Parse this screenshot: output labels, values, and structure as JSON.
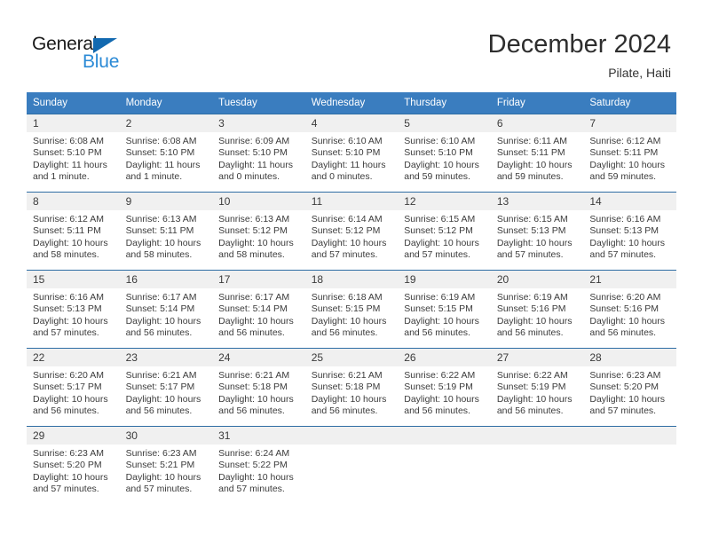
{
  "brand": {
    "name_part1": "General",
    "name_part2": "Blue",
    "accent_color": "#1269b0",
    "blue_text_color": "#2b8ad6"
  },
  "header": {
    "month_title": "December 2024",
    "location": "Pilate, Haiti"
  },
  "calendar": {
    "header_bg": "#3a7dbf",
    "row_divider_color": "#2e6da4",
    "daynum_bg": "#f0f0f0",
    "weekday_headers": [
      "Sunday",
      "Monday",
      "Tuesday",
      "Wednesday",
      "Thursday",
      "Friday",
      "Saturday"
    ],
    "weeks": [
      [
        {
          "day": "1",
          "sunrise": "Sunrise: 6:08 AM",
          "sunset": "Sunset: 5:10 PM",
          "daylight": "Daylight: 11 hours and 1 minute."
        },
        {
          "day": "2",
          "sunrise": "Sunrise: 6:08 AM",
          "sunset": "Sunset: 5:10 PM",
          "daylight": "Daylight: 11 hours and 1 minute."
        },
        {
          "day": "3",
          "sunrise": "Sunrise: 6:09 AM",
          "sunset": "Sunset: 5:10 PM",
          "daylight": "Daylight: 11 hours and 0 minutes."
        },
        {
          "day": "4",
          "sunrise": "Sunrise: 6:10 AM",
          "sunset": "Sunset: 5:10 PM",
          "daylight": "Daylight: 11 hours and 0 minutes."
        },
        {
          "day": "5",
          "sunrise": "Sunrise: 6:10 AM",
          "sunset": "Sunset: 5:10 PM",
          "daylight": "Daylight: 10 hours and 59 minutes."
        },
        {
          "day": "6",
          "sunrise": "Sunrise: 6:11 AM",
          "sunset": "Sunset: 5:11 PM",
          "daylight": "Daylight: 10 hours and 59 minutes."
        },
        {
          "day": "7",
          "sunrise": "Sunrise: 6:12 AM",
          "sunset": "Sunset: 5:11 PM",
          "daylight": "Daylight: 10 hours and 59 minutes."
        }
      ],
      [
        {
          "day": "8",
          "sunrise": "Sunrise: 6:12 AM",
          "sunset": "Sunset: 5:11 PM",
          "daylight": "Daylight: 10 hours and 58 minutes."
        },
        {
          "day": "9",
          "sunrise": "Sunrise: 6:13 AM",
          "sunset": "Sunset: 5:11 PM",
          "daylight": "Daylight: 10 hours and 58 minutes."
        },
        {
          "day": "10",
          "sunrise": "Sunrise: 6:13 AM",
          "sunset": "Sunset: 5:12 PM",
          "daylight": "Daylight: 10 hours and 58 minutes."
        },
        {
          "day": "11",
          "sunrise": "Sunrise: 6:14 AM",
          "sunset": "Sunset: 5:12 PM",
          "daylight": "Daylight: 10 hours and 57 minutes."
        },
        {
          "day": "12",
          "sunrise": "Sunrise: 6:15 AM",
          "sunset": "Sunset: 5:12 PM",
          "daylight": "Daylight: 10 hours and 57 minutes."
        },
        {
          "day": "13",
          "sunrise": "Sunrise: 6:15 AM",
          "sunset": "Sunset: 5:13 PM",
          "daylight": "Daylight: 10 hours and 57 minutes."
        },
        {
          "day": "14",
          "sunrise": "Sunrise: 6:16 AM",
          "sunset": "Sunset: 5:13 PM",
          "daylight": "Daylight: 10 hours and 57 minutes."
        }
      ],
      [
        {
          "day": "15",
          "sunrise": "Sunrise: 6:16 AM",
          "sunset": "Sunset: 5:13 PM",
          "daylight": "Daylight: 10 hours and 57 minutes."
        },
        {
          "day": "16",
          "sunrise": "Sunrise: 6:17 AM",
          "sunset": "Sunset: 5:14 PM",
          "daylight": "Daylight: 10 hours and 56 minutes."
        },
        {
          "day": "17",
          "sunrise": "Sunrise: 6:17 AM",
          "sunset": "Sunset: 5:14 PM",
          "daylight": "Daylight: 10 hours and 56 minutes."
        },
        {
          "day": "18",
          "sunrise": "Sunrise: 6:18 AM",
          "sunset": "Sunset: 5:15 PM",
          "daylight": "Daylight: 10 hours and 56 minutes."
        },
        {
          "day": "19",
          "sunrise": "Sunrise: 6:19 AM",
          "sunset": "Sunset: 5:15 PM",
          "daylight": "Daylight: 10 hours and 56 minutes."
        },
        {
          "day": "20",
          "sunrise": "Sunrise: 6:19 AM",
          "sunset": "Sunset: 5:16 PM",
          "daylight": "Daylight: 10 hours and 56 minutes."
        },
        {
          "day": "21",
          "sunrise": "Sunrise: 6:20 AM",
          "sunset": "Sunset: 5:16 PM",
          "daylight": "Daylight: 10 hours and 56 minutes."
        }
      ],
      [
        {
          "day": "22",
          "sunrise": "Sunrise: 6:20 AM",
          "sunset": "Sunset: 5:17 PM",
          "daylight": "Daylight: 10 hours and 56 minutes."
        },
        {
          "day": "23",
          "sunrise": "Sunrise: 6:21 AM",
          "sunset": "Sunset: 5:17 PM",
          "daylight": "Daylight: 10 hours and 56 minutes."
        },
        {
          "day": "24",
          "sunrise": "Sunrise: 6:21 AM",
          "sunset": "Sunset: 5:18 PM",
          "daylight": "Daylight: 10 hours and 56 minutes."
        },
        {
          "day": "25",
          "sunrise": "Sunrise: 6:21 AM",
          "sunset": "Sunset: 5:18 PM",
          "daylight": "Daylight: 10 hours and 56 minutes."
        },
        {
          "day": "26",
          "sunrise": "Sunrise: 6:22 AM",
          "sunset": "Sunset: 5:19 PM",
          "daylight": "Daylight: 10 hours and 56 minutes."
        },
        {
          "day": "27",
          "sunrise": "Sunrise: 6:22 AM",
          "sunset": "Sunset: 5:19 PM",
          "daylight": "Daylight: 10 hours and 56 minutes."
        },
        {
          "day": "28",
          "sunrise": "Sunrise: 6:23 AM",
          "sunset": "Sunset: 5:20 PM",
          "daylight": "Daylight: 10 hours and 57 minutes."
        }
      ],
      [
        {
          "day": "29",
          "sunrise": "Sunrise: 6:23 AM",
          "sunset": "Sunset: 5:20 PM",
          "daylight": "Daylight: 10 hours and 57 minutes."
        },
        {
          "day": "30",
          "sunrise": "Sunrise: 6:23 AM",
          "sunset": "Sunset: 5:21 PM",
          "daylight": "Daylight: 10 hours and 57 minutes."
        },
        {
          "day": "31",
          "sunrise": "Sunrise: 6:24 AM",
          "sunset": "Sunset: 5:22 PM",
          "daylight": "Daylight: 10 hours and 57 minutes."
        },
        {
          "day": "",
          "sunrise": "",
          "sunset": "",
          "daylight": ""
        },
        {
          "day": "",
          "sunrise": "",
          "sunset": "",
          "daylight": ""
        },
        {
          "day": "",
          "sunrise": "",
          "sunset": "",
          "daylight": ""
        },
        {
          "day": "",
          "sunrise": "",
          "sunset": "",
          "daylight": ""
        }
      ]
    ]
  }
}
